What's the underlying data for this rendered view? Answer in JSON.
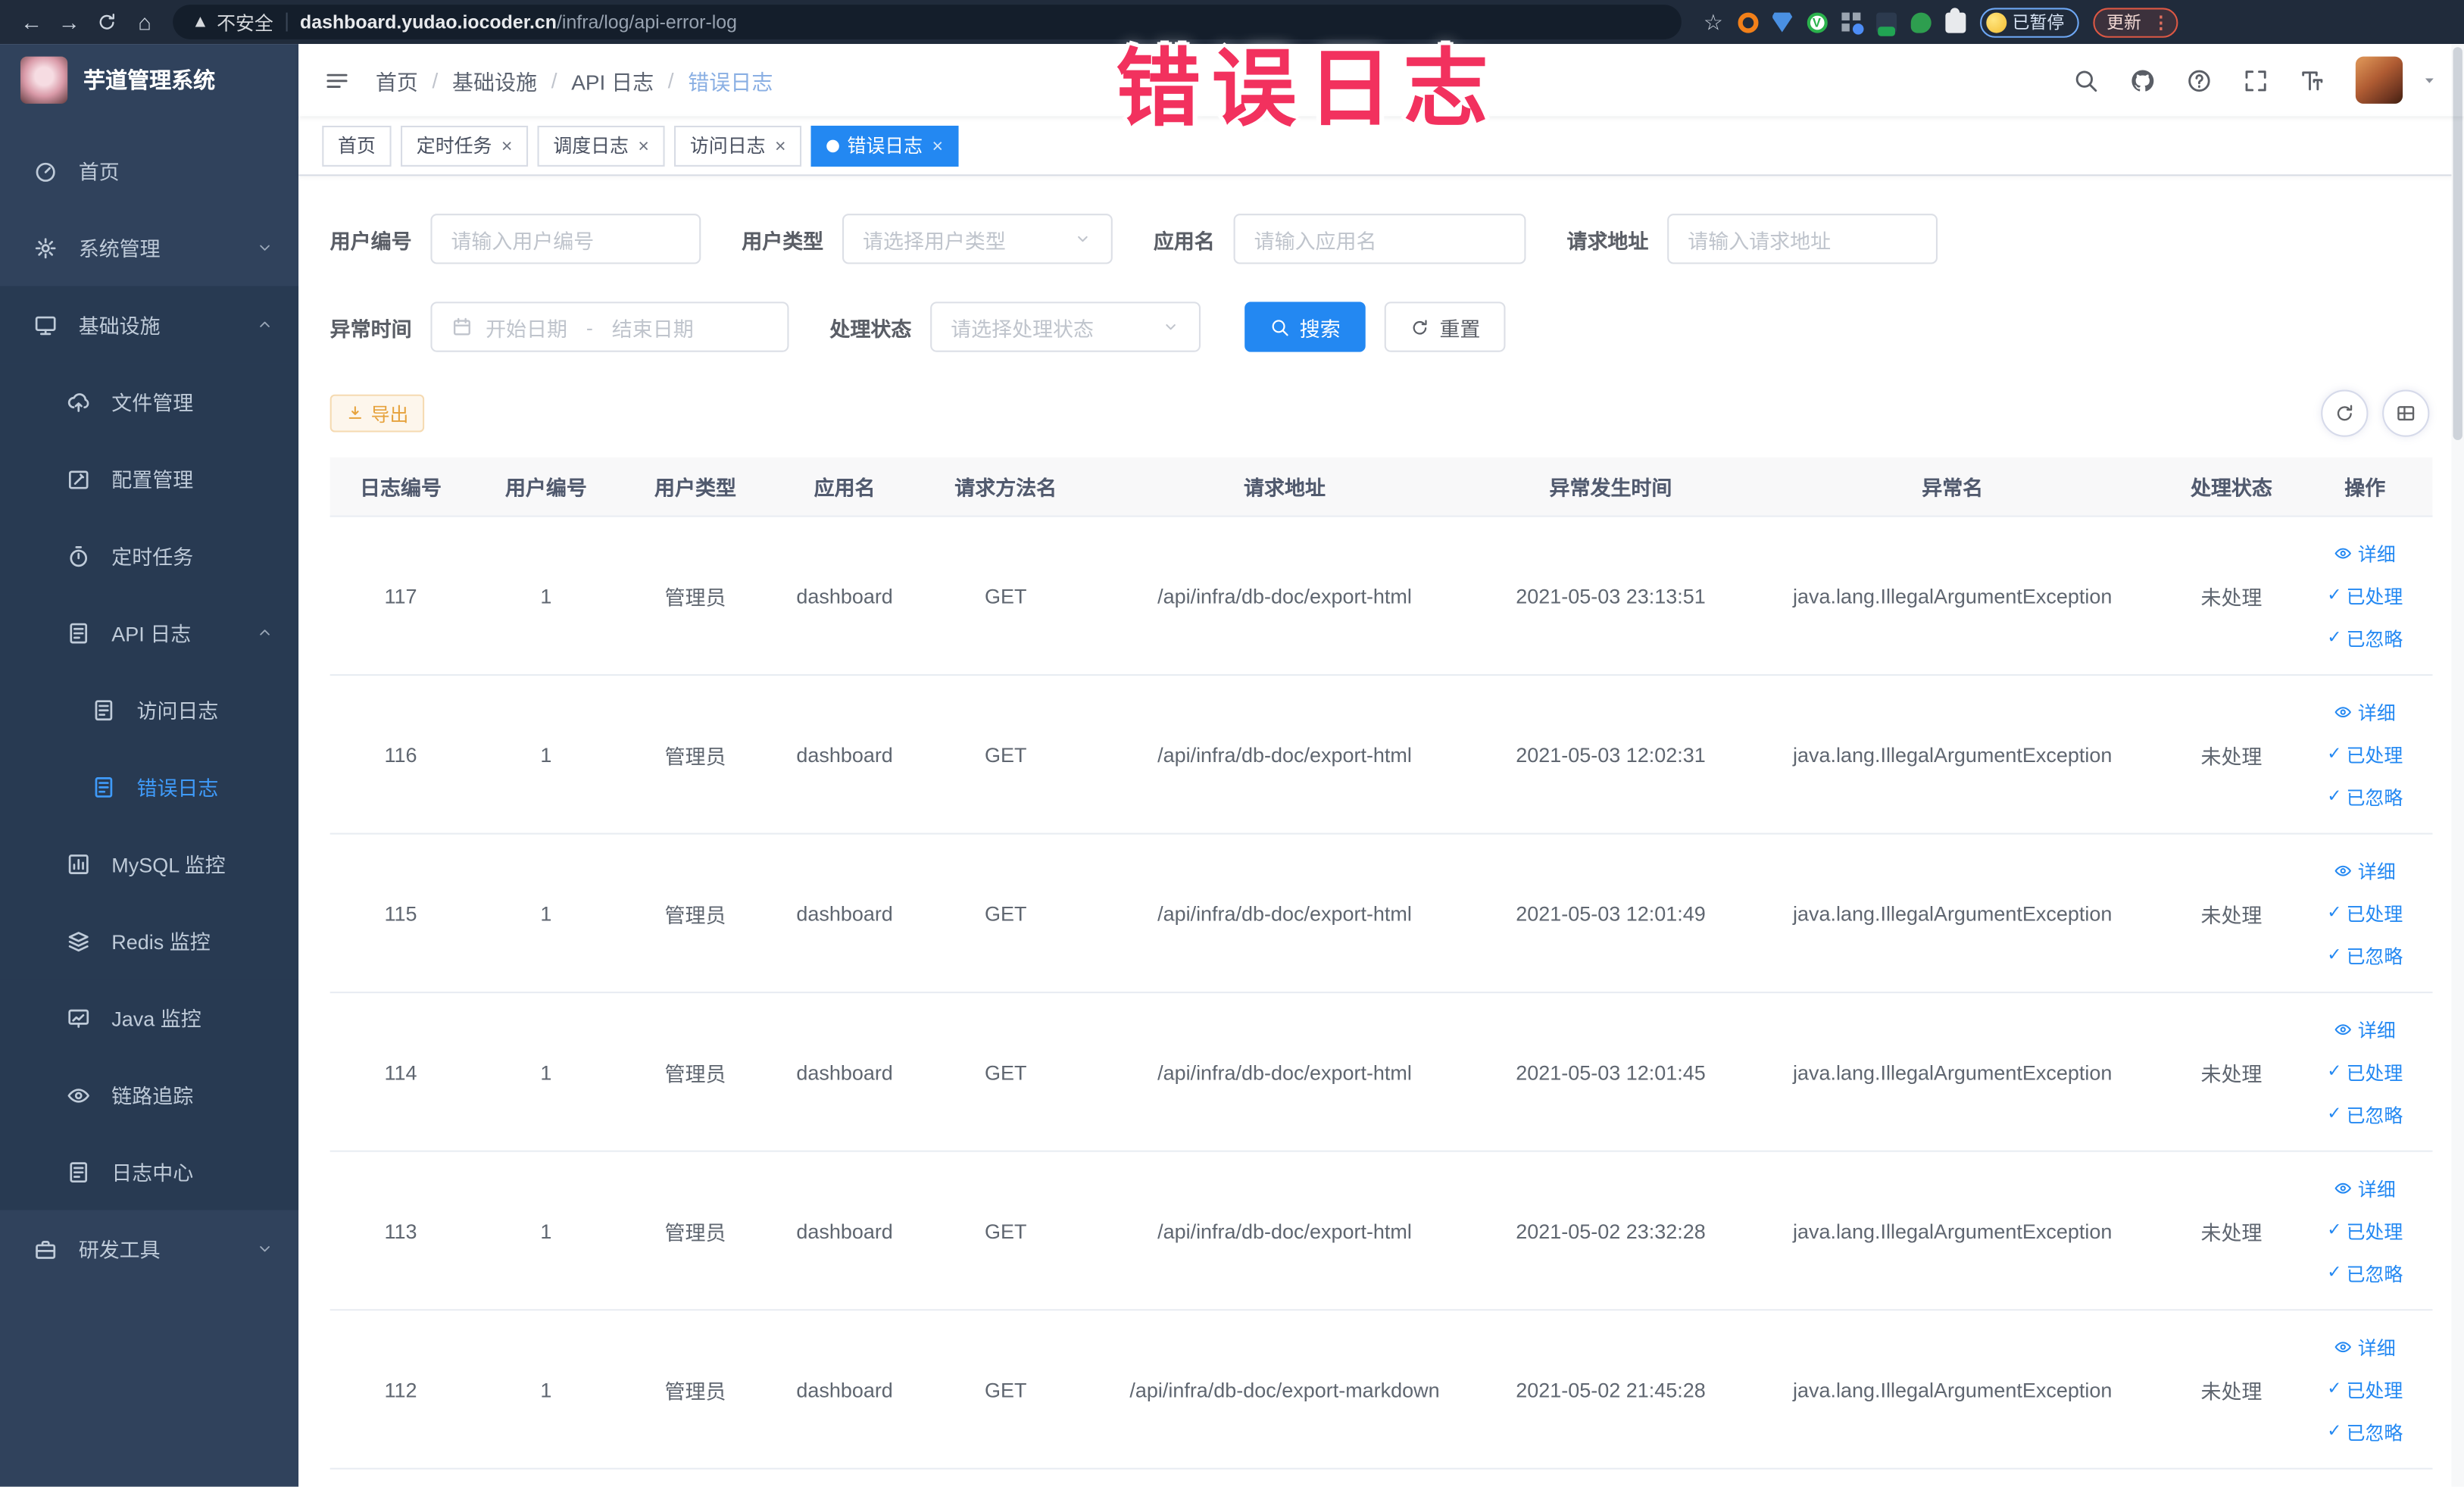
{
  "browser": {
    "security_label": "不安全",
    "url_domain": "dashboard.yudao.iocoder.cn",
    "url_path": "/infra/log/api-error-log",
    "paused_button": "已暂停",
    "update_button": "更新"
  },
  "overlay": {
    "text": "错误日志",
    "color": "#f2315e"
  },
  "sidebar": {
    "logo_title": "芋道管理系统",
    "items": [
      {
        "key": "home",
        "label": "首页",
        "icon": "dashboard-icon",
        "level": 1
      },
      {
        "key": "system",
        "label": "系统管理",
        "icon": "gear-icon",
        "level": 1,
        "chevron": "down"
      },
      {
        "key": "infra",
        "label": "基础设施",
        "icon": "infrastructure-icon",
        "level": 1,
        "chevron": "up",
        "block": true
      },
      {
        "key": "file",
        "label": "文件管理",
        "icon": "file-icon",
        "level": 2,
        "block": true
      },
      {
        "key": "config",
        "label": "配置管理",
        "icon": "config-icon",
        "level": 2,
        "block": true
      },
      {
        "key": "job",
        "label": "定时任务",
        "icon": "timer-icon",
        "level": 2,
        "block": true
      },
      {
        "key": "api-log",
        "label": "API 日志",
        "icon": "api-log-icon",
        "level": 2,
        "chevron": "up",
        "block": true
      },
      {
        "key": "access-log",
        "label": "访问日志",
        "icon": "access-log-icon",
        "level": 3,
        "block": true
      },
      {
        "key": "error-log",
        "label": "错误日志",
        "icon": "error-log-icon",
        "level": 3,
        "block": true,
        "active": true
      },
      {
        "key": "mysql",
        "label": "MySQL 监控",
        "icon": "mysql-icon",
        "level": 2,
        "block": true
      },
      {
        "key": "redis",
        "label": "Redis 监控",
        "icon": "redis-icon",
        "level": 2,
        "block": true
      },
      {
        "key": "java",
        "label": "Java 监控",
        "icon": "java-icon",
        "level": 2,
        "block": true
      },
      {
        "key": "trace",
        "label": "链路追踪",
        "icon": "trace-icon",
        "level": 2,
        "block": true
      },
      {
        "key": "log-center",
        "label": "日志中心",
        "icon": "log-center-icon",
        "level": 2,
        "block": true
      },
      {
        "key": "devtools",
        "label": "研发工具",
        "icon": "devtools-icon",
        "level": 1,
        "chevron": "down"
      }
    ]
  },
  "header": {
    "breadcrumb": [
      "首页",
      "基础设施",
      "API 日志",
      "错误日志"
    ]
  },
  "tabs": [
    {
      "label": "首页",
      "closable": false,
      "active": false
    },
    {
      "label": "定时任务",
      "closable": true,
      "active": false
    },
    {
      "label": "调度日志",
      "closable": true,
      "active": false
    },
    {
      "label": "访问日志",
      "closable": true,
      "active": false
    },
    {
      "label": "错误日志",
      "closable": true,
      "active": true
    }
  ],
  "filters": {
    "row1": [
      {
        "key": "user-id",
        "label": "用户编号",
        "type": "input",
        "placeholder": "请输入用户编号"
      },
      {
        "key": "user-type",
        "label": "用户类型",
        "type": "select",
        "placeholder": "请选择用户类型"
      },
      {
        "key": "app-name",
        "label": "应用名",
        "type": "input",
        "placeholder": "请输入应用名"
      },
      {
        "key": "req-url",
        "label": "请求地址",
        "type": "input",
        "placeholder": "请输入请求地址"
      }
    ],
    "row2": [
      {
        "key": "exception-time",
        "label": "异常时间",
        "type": "daterange",
        "start_placeholder": "开始日期",
        "end_placeholder": "结束日期",
        "separator": "-"
      },
      {
        "key": "process-status",
        "label": "处理状态",
        "type": "select",
        "placeholder": "请选择处理状态"
      }
    ],
    "search_button": "搜索",
    "reset_button": "重置"
  },
  "toolbar": {
    "export_label": "导出"
  },
  "table": {
    "columns": [
      "日志编号",
      "用户编号",
      "用户类型",
      "应用名",
      "请求方法名",
      "请求地址",
      "异常发生时间",
      "异常名",
      "处理状态",
      "操作"
    ],
    "actions": [
      {
        "key": "detail",
        "label": "详细",
        "icon": "eye-icon"
      },
      {
        "key": "done",
        "label": "已处理",
        "icon": "check-icon"
      },
      {
        "key": "ignore",
        "label": "已忽略",
        "icon": "check-icon"
      }
    ],
    "rows": [
      {
        "id": "117",
        "user_id": "1",
        "user_type": "管理员",
        "app": "dashboard",
        "method": "GET",
        "url": "/api/infra/db-doc/export-html",
        "time": "2021-05-03 23:13:51",
        "exception": "java.lang.IllegalArgumentException",
        "status": "未处理"
      },
      {
        "id": "116",
        "user_id": "1",
        "user_type": "管理员",
        "app": "dashboard",
        "method": "GET",
        "url": "/api/infra/db-doc/export-html",
        "time": "2021-05-03 12:02:31",
        "exception": "java.lang.IllegalArgumentException",
        "status": "未处理"
      },
      {
        "id": "115",
        "user_id": "1",
        "user_type": "管理员",
        "app": "dashboard",
        "method": "GET",
        "url": "/api/infra/db-doc/export-html",
        "time": "2021-05-03 12:01:49",
        "exception": "java.lang.IllegalArgumentException",
        "status": "未处理"
      },
      {
        "id": "114",
        "user_id": "1",
        "user_type": "管理员",
        "app": "dashboard",
        "method": "GET",
        "url": "/api/infra/db-doc/export-html",
        "time": "2021-05-03 12:01:45",
        "exception": "java.lang.IllegalArgumentException",
        "status": "未处理"
      },
      {
        "id": "113",
        "user_id": "1",
        "user_type": "管理员",
        "app": "dashboard",
        "method": "GET",
        "url": "/api/infra/db-doc/export-html",
        "time": "2021-05-02 23:32:28",
        "exception": "java.lang.IllegalArgumentException",
        "status": "未处理"
      },
      {
        "id": "112",
        "user_id": "1",
        "user_type": "管理员",
        "app": "dashboard",
        "method": "GET",
        "url": "/api/infra/db-doc/export-markdown",
        "time": "2021-05-02 21:45:28",
        "exception": "java.lang.IllegalArgumentException",
        "status": "未处理"
      }
    ]
  },
  "colors": {
    "primary": "#2388f2",
    "warning": "#e6a23c",
    "sidebar_bg": "#30425c",
    "sidebar_submenu_bg": "#283a52",
    "active_link": "#3f9bfa",
    "overlay_red": "#f2315e"
  }
}
